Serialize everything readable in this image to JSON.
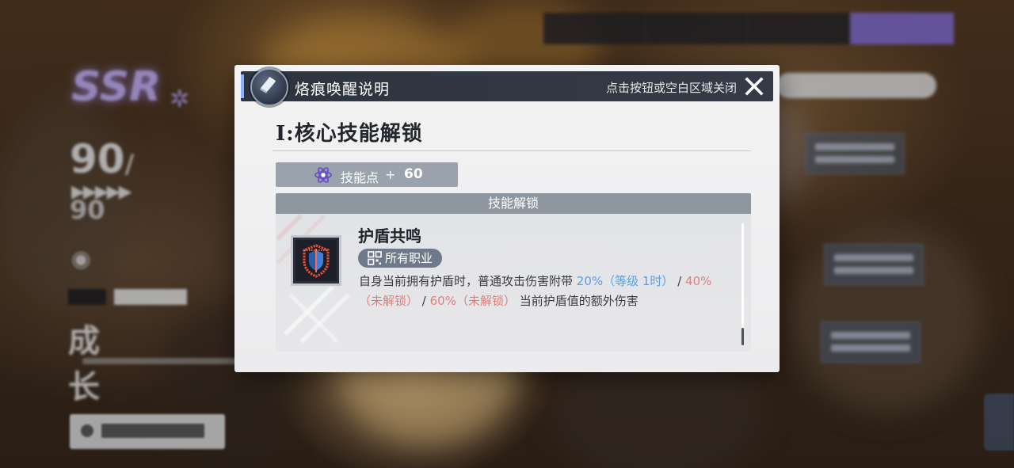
{
  "modal": {
    "title": "烙痕唤醒说明",
    "close_hint": "点击按钮或空白区域关闭",
    "section_title": "I:核心技能解锁",
    "skill_points": {
      "label": "技能点",
      "plus": "+",
      "value": "60"
    },
    "unlock_header": "技能解锁",
    "skill": {
      "name": "护盾共鸣",
      "class_tag": "所有职业",
      "desc_prefix": "自身当前拥有护盾时，普通攻击伤害附带 ",
      "tier1": "20%（等级 1时）",
      "sep1": " / ",
      "tier2": "40%（未解锁）",
      "sep2": " / ",
      "tier3": "60%（未解锁）",
      "desc_suffix": " 当前护盾值的额外伤害"
    }
  },
  "colors": {
    "header_bg": "#2d3440",
    "accent": "#8ab0ff",
    "unlocked_value": "#5a9ee6",
    "locked_value": "#e07f7a",
    "tag_bg": "#6e7a8a",
    "active_tab": "#8a74d6"
  },
  "icons": {
    "header": "wing-feather-icon",
    "close": "close-icon",
    "skill_points": "atom-icon",
    "class_tag": "grid-icon",
    "skill": "shield-skill-icon"
  }
}
